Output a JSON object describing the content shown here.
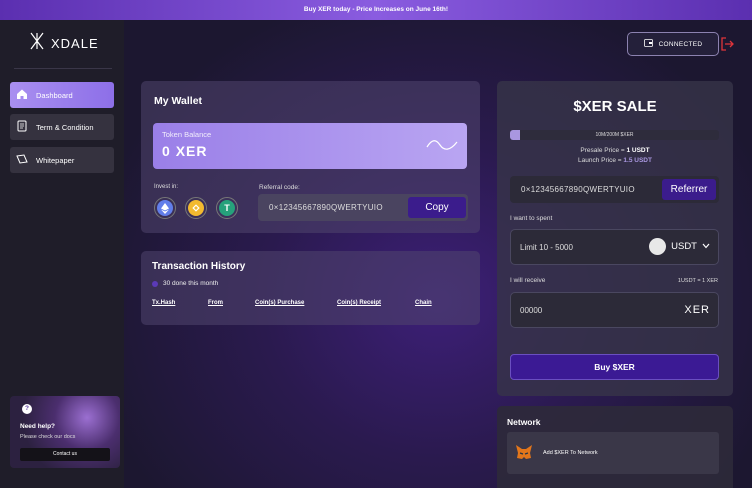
{
  "banner": {
    "text": "Buy XER today - Price Increases on June 16th!"
  },
  "brand": {
    "name": "XDALE"
  },
  "sidebar": {
    "items": [
      {
        "label": "Dashboard",
        "icon": "home-icon",
        "active": true
      },
      {
        "label": "Term & Condition",
        "icon": "document-icon",
        "active": false
      },
      {
        "label": "Whitepaper",
        "icon": "paper-icon",
        "active": false
      }
    ],
    "help": {
      "title": "Need help?",
      "subtitle": "Please check our docs",
      "button": "Contact us"
    }
  },
  "header": {
    "connected_label": "CONNECTED",
    "logout_icon": "logout-icon"
  },
  "wallet": {
    "title": "My Wallet",
    "token_balance_label": "Token Balance",
    "token_balance_value": "0",
    "token_symbol": "XER",
    "invest_label": "Invest in:",
    "coins": [
      "ethereum-icon",
      "bnb-icon",
      "tether-icon"
    ],
    "referral_label": "Referral code:",
    "referral_code": "0×12345667890QWERTYUIO",
    "copy_label": "Copy"
  },
  "transactions": {
    "title": "Transaction History",
    "subtitle": "30 done this month",
    "columns": [
      "Tx.Hash",
      "From",
      "Coin(s) Purchase",
      "Coin(s) Receipt",
      "Chain"
    ]
  },
  "sale": {
    "title": "$XER SALE",
    "progress_text": "10M/200M $XER",
    "progress_fraction": 0.05,
    "presale_label": "Presale Price = ",
    "presale_value": "1 USDT",
    "launch_label": "Launch Price = ",
    "launch_value": "1.5 USDT",
    "referral_code": "0×12345667890QWERTYUIO",
    "referrer_label": "Referrer",
    "spend_label": "I want to spent",
    "spend_placeholder": "Limit 10 - 5000",
    "spend_currency": "USDT",
    "receive_label": "I will receive",
    "rate": "1USDT = 1 XER",
    "receive_value": "00000",
    "receive_symbol": "XER",
    "buy_label": "Buy $XER"
  },
  "network": {
    "title": "Network",
    "item_label": "Add $XER To Network",
    "item_icon": "metamask-fox-icon"
  },
  "colors": {
    "accent": "#3b1c8c",
    "accent_light": "#a997e0",
    "banner": "#7a4fd0"
  }
}
